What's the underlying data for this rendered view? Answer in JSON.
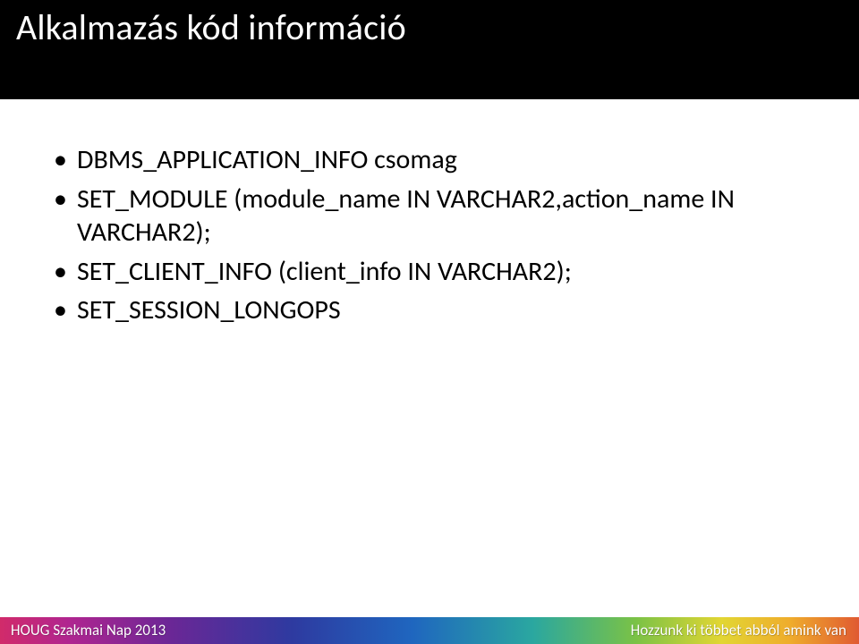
{
  "slide": {
    "title": "Alkalmazás kód információ",
    "bullets": [
      "DBMS_APPLICATION_INFO csomag",
      "SET_MODULE (module_name IN VARCHAR2,action_name IN VARCHAR2);",
      "SET_CLIENT_INFO (client_info IN VARCHAR2);",
      "SET_SESSION_LONGOPS"
    ],
    "footer_left": "HOUG Szakmai Nap 2013",
    "footer_right": "Hozzunk ki többet abból amink van"
  }
}
